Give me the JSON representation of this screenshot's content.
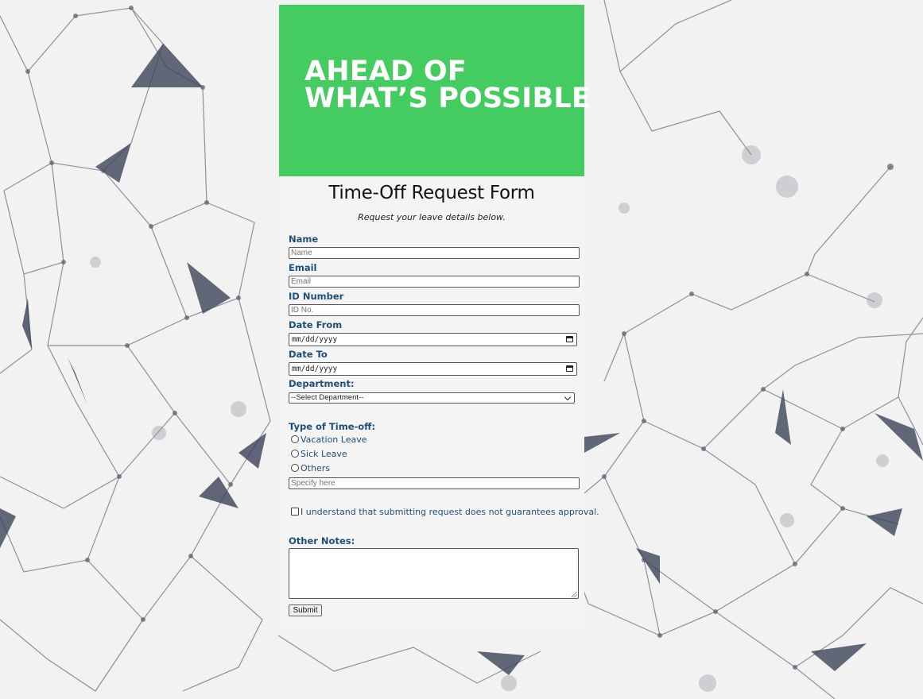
{
  "banner": {
    "line1": "AHEAD OF",
    "line2": "WHAT’S POSSIBLE",
    "color": "#45cc61"
  },
  "form": {
    "title": "Time-Off Request Form",
    "subtitle": "Request your leave details below.",
    "name": {
      "label": "Name",
      "placeholder": "Name"
    },
    "email": {
      "label": "Email",
      "placeholder": "Email"
    },
    "id_number": {
      "label": "ID Number",
      "placeholder": "ID No."
    },
    "date_from": {
      "label": "Date From",
      "value": "mm/dd/yyyy"
    },
    "date_to": {
      "label": "Date To",
      "value": "mm/dd/yyyy"
    },
    "department": {
      "label": "Department:",
      "selected": "--Select Department--"
    },
    "timeoff": {
      "label": "Type of Time-off:",
      "options": [
        "Vacation Leave",
        "Sick Leave",
        "Others"
      ],
      "specify_placeholder": "Specify here"
    },
    "agreement": "I understand that submitting request does not guarantees approval.",
    "notes_label": "Other Notes:",
    "submit_label": "Submit"
  },
  "colors": {
    "label_blue": "#1f4e79",
    "panel": "#f4f4f4",
    "page_bg": "#f2f2f2"
  }
}
